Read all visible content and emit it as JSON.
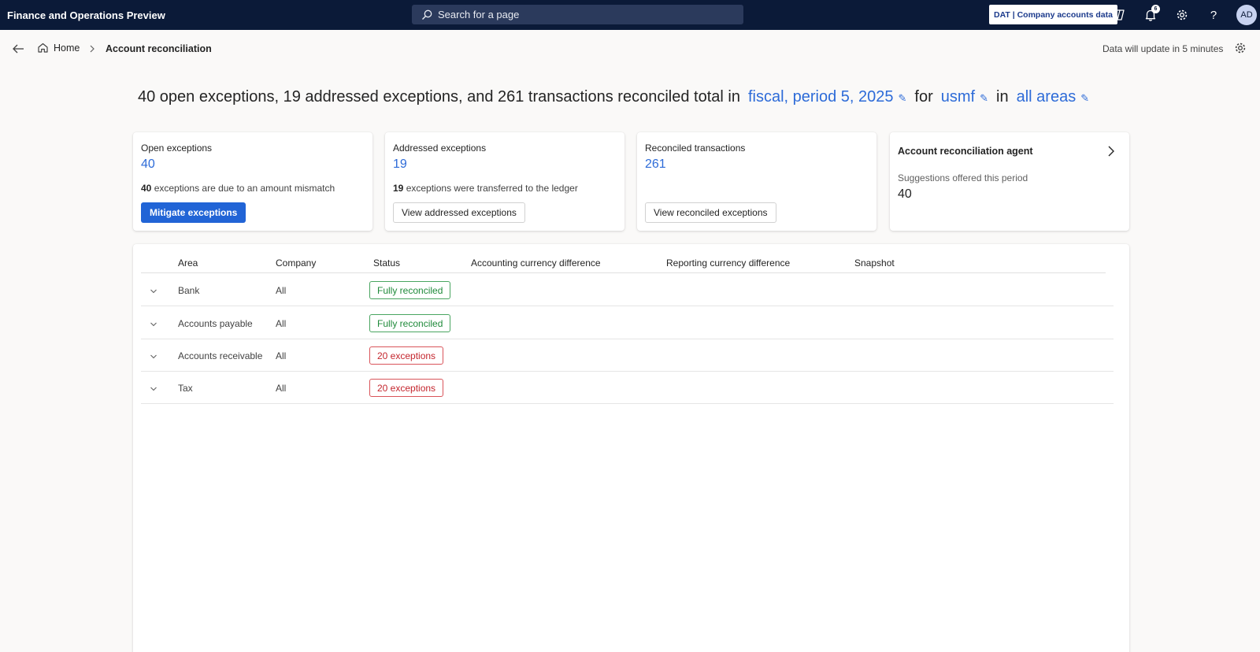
{
  "app": {
    "title": "Finance and Operations Preview",
    "search_placeholder": "Search for a page",
    "company_chip": "DAT | Company accounts data",
    "notification_count": "6",
    "avatar_initials": "AD",
    "colors": {
      "topbar": "#0b1a38",
      "accent": "#2164d6",
      "link": "#2d6bd8",
      "success": "#1f8a3a",
      "danger": "#c4262e"
    }
  },
  "breadcrumb": {
    "home": "Home",
    "current": "Account reconciliation"
  },
  "update_notice": "Data will update in 5 minutes",
  "headline": {
    "prefix": "40 open exceptions, 19 addressed exceptions, and 261 transactions reconciled total in",
    "period": "fiscal, period 5, 2025",
    "for_word": "for",
    "company": "usmf",
    "in_word": "in",
    "areas": "all areas"
  },
  "cards": {
    "open": {
      "title": "Open exceptions",
      "value": "40",
      "desc_count": "40",
      "desc_text": "exceptions are due to an amount mismatch",
      "button": "Mitigate exceptions"
    },
    "addressed": {
      "title": "Addressed exceptions",
      "value": "19",
      "desc_count": "19",
      "desc_text": "exceptions were transferred to the ledger",
      "button": "View addressed exceptions"
    },
    "reconciled": {
      "title": "Reconciled transactions",
      "value": "261",
      "button": "View reconciled exceptions"
    },
    "agent": {
      "title": "Account reconciliation agent",
      "subtitle": "Suggestions offered this period",
      "value": "40"
    }
  },
  "table": {
    "columns": [
      "Area",
      "Company",
      "Status",
      "Accounting currency difference",
      "Reporting currency difference",
      "Snapshot"
    ],
    "rows": [
      {
        "area": "Bank",
        "company": "All",
        "status": "Fully reconciled",
        "status_type": "ok"
      },
      {
        "area": "Accounts payable",
        "company": "All",
        "status": "Fully reconciled",
        "status_type": "ok"
      },
      {
        "area": "Accounts receivable",
        "company": "All",
        "status": "20 exceptions",
        "status_type": "bad"
      },
      {
        "area": "Tax",
        "company": "All",
        "status": "20 exceptions",
        "status_type": "bad"
      }
    ]
  }
}
